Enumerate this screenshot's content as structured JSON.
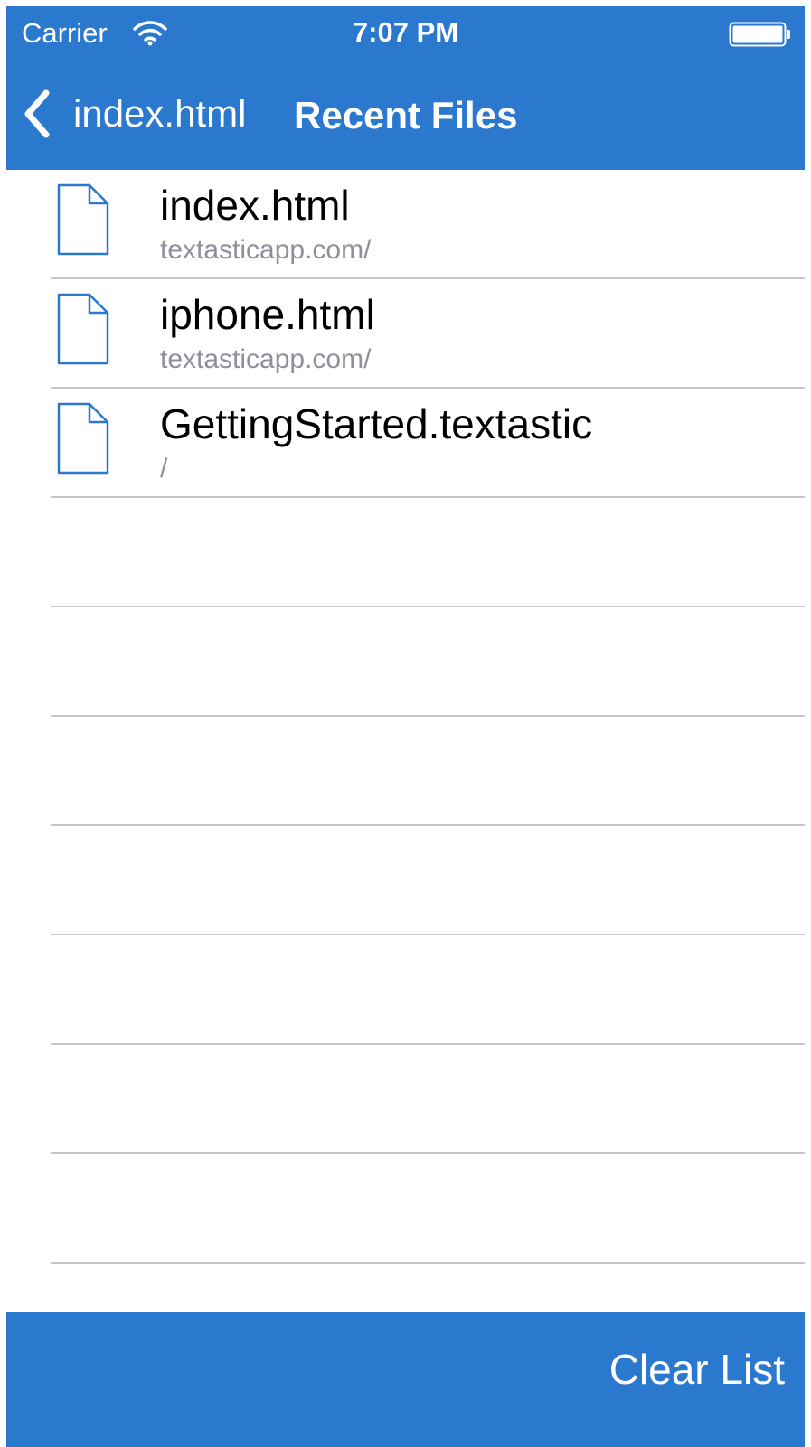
{
  "status_bar": {
    "carrier": "Carrier",
    "time": "7:07 PM",
    "wifi_icon": "wifi-icon",
    "battery_icon": "battery-full-icon"
  },
  "nav": {
    "back_label": "index.html",
    "back_icon": "chevron-left-icon",
    "title": "Recent Files"
  },
  "files": [
    {
      "name": "index.html",
      "path": "textasticapp.com/",
      "icon": "document-icon"
    },
    {
      "name": "iphone.html",
      "path": "textasticapp.com/",
      "icon": "document-icon"
    },
    {
      "name": "GettingStarted.textastic",
      "path": "/",
      "icon": "document-icon"
    }
  ],
  "toolbar": {
    "clear_label": "Clear List"
  },
  "colors": {
    "accent": "#2a79cf",
    "subtitle": "#8c919c",
    "separator": "#c8c7cc"
  }
}
